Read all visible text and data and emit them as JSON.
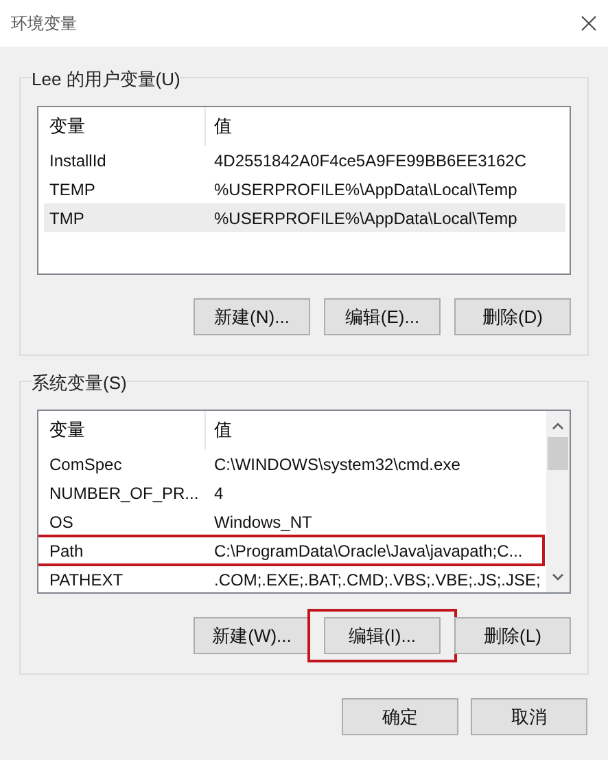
{
  "window": {
    "title": "环境变量"
  },
  "user_vars": {
    "label": "Lee 的用户变量(U)",
    "columns": [
      "变量",
      "值"
    ],
    "rows": [
      {
        "name": "InstallId",
        "value": "4D2551842A0F4ce5A9FE99BB6EE3162C",
        "selected": false
      },
      {
        "name": "TEMP",
        "value": "%USERPROFILE%\\AppData\\Local\\Temp",
        "selected": false
      },
      {
        "name": "TMP",
        "value": "%USERPROFILE%\\AppData\\Local\\Temp",
        "selected": true
      }
    ],
    "buttons": [
      {
        "label": "新建(N)...",
        "highlighted": false
      },
      {
        "label": "编辑(E)...",
        "highlighted": false
      },
      {
        "label": "删除(D)",
        "highlighted": false
      }
    ]
  },
  "system_vars": {
    "label": "系统变量(S)",
    "columns": [
      "变量",
      "值"
    ],
    "rows": [
      {
        "name": "ComSpec",
        "value": "C:\\WINDOWS\\system32\\cmd.exe",
        "selected": false,
        "highlighted": false
      },
      {
        "name": "NUMBER_OF_PR...",
        "value": "4",
        "selected": false,
        "highlighted": false
      },
      {
        "name": "OS",
        "value": "Windows_NT",
        "selected": false,
        "highlighted": false
      },
      {
        "name": "Path",
        "value": "C:\\ProgramData\\Oracle\\Java\\javapath;C...",
        "selected": false,
        "highlighted": true
      },
      {
        "name": "PATHEXT",
        "value": ".COM;.EXE;.BAT;.CMD;.VBS;.VBE;.JS;.JSE;",
        "selected": false,
        "highlighted": false
      }
    ],
    "buttons": [
      {
        "label": "新建(W)...",
        "highlighted": false
      },
      {
        "label": "编辑(I)...",
        "highlighted": true
      },
      {
        "label": "删除(L)",
        "highlighted": false
      }
    ]
  },
  "footer_buttons": [
    {
      "label": "确定"
    },
    {
      "label": "取消"
    }
  ]
}
